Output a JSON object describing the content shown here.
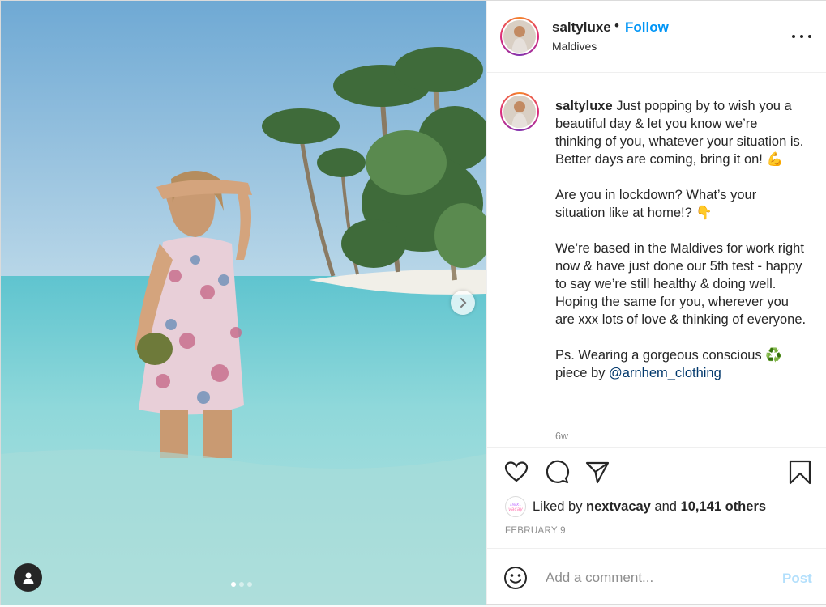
{
  "header": {
    "username": "saltyluxe",
    "separator": "•",
    "follow_label": "Follow",
    "location": "Maldives"
  },
  "caption": {
    "username": "saltyluxe",
    "paragraphs": [
      "Just popping by to wish you a beautiful day & let you know we’re thinking of you, whatever your situation is. Better days are coming, bring it on! 💪",
      "Are you in lockdown? What’s your situation like at home!? 👇",
      "We’re based in the Maldives for work right now & have just done our 5th test - happy to say we’re still healthy & doing well. Hoping the same for you, wherever you are xxx lots of love & thinking of everyone."
    ],
    "last_paragraph_prefix": "Ps. Wearing a gorgeous conscious ♻️ piece by ",
    "mention": "@arnhem_clothing",
    "time_ago": "6w"
  },
  "likes": {
    "prefix": "Liked by ",
    "liker": "nextvacay",
    "middle": " and ",
    "count_text": "10,141 others",
    "liker_avatar_text": "next vacay"
  },
  "date": "FEBRUARY 9",
  "comment": {
    "placeholder": "Add a comment...",
    "post_label": "Post"
  },
  "carousel": {
    "slide_count": 3,
    "active_slide": 1
  },
  "colors": {
    "follow": "#0095f6",
    "post_disabled": "#b2dffc",
    "mention": "#00376b",
    "secondary_text": "#8e8e8e"
  },
  "icons": [
    "heart-icon",
    "comment-icon",
    "share-icon",
    "bookmark-icon",
    "emoji-icon",
    "more-icon",
    "chevron-right-icon",
    "user-tag-icon"
  ]
}
